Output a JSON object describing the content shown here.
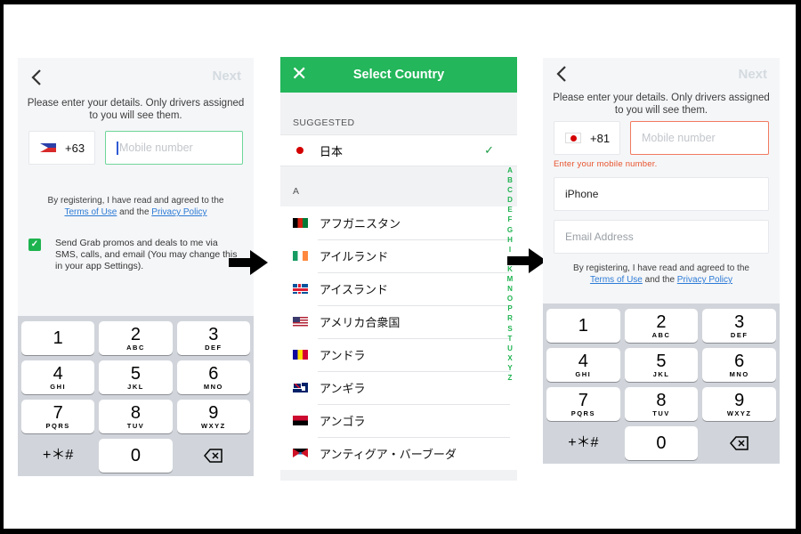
{
  "screen1": {
    "back_label": "‹",
    "next_label": "Next",
    "intro": "Please enter your details. Only drivers assigned to you will see them.",
    "country_code": "+63",
    "country_flag": "philippines-flag",
    "mobile_placeholder": "Mobile number",
    "terms_prefix": "By registering, I have read and agreed to the",
    "terms_link": "Terms of Use",
    "terms_mid": "and the",
    "privacy_link": "Privacy Policy",
    "promo_checked": true,
    "promo_text": "Send Grab promos and deals to me via SMS, calls, and email (You may change this in your app Settings)."
  },
  "screen2": {
    "title": "Select Country",
    "close_icon": "close-icon",
    "suggested_header": "SUGGESTED",
    "suggested": [
      {
        "name": "日本",
        "flag": "japan-flag",
        "selected": true
      }
    ],
    "section_header": "A",
    "countries": [
      {
        "name": "アフガニスタン",
        "flag": "af"
      },
      {
        "name": "アイルランド",
        "flag": "ie"
      },
      {
        "name": "アイスランド",
        "flag": "is"
      },
      {
        "name": "アメリカ合衆国",
        "flag": "us"
      },
      {
        "name": "アンドラ",
        "flag": "ad"
      },
      {
        "name": "アンギラ",
        "flag": "ai"
      },
      {
        "name": "アンゴラ",
        "flag": "ao"
      },
      {
        "name": "アンティグア・バーブーダ",
        "flag": "ag"
      }
    ],
    "index_letters": [
      "A",
      "B",
      "C",
      "D",
      "E",
      "F",
      "G",
      "H",
      "I",
      "J",
      "K",
      "M",
      "N",
      "O",
      "P",
      "R",
      "S",
      "T",
      "U",
      "X",
      "Y",
      "Z"
    ],
    "accent_color": "#23b65a"
  },
  "screen3": {
    "back_label": "‹",
    "next_label": "Next",
    "intro": "Please enter your details. Only drivers assigned to you will see them.",
    "country_code": "+81",
    "country_flag": "japan-flag",
    "mobile_placeholder": "Mobile number",
    "error_message": "Enter your mobile number.",
    "name_value": "iPhone",
    "email_placeholder": "Email Address",
    "terms_prefix": "By registering, I have read and agreed to the",
    "terms_link": "Terms of Use",
    "terms_mid": "and the",
    "privacy_link": "Privacy Policy",
    "error_color": "#e8532d"
  },
  "keypad": {
    "keys": [
      {
        "n": "1",
        "l": ""
      },
      {
        "n": "2",
        "l": "ABC"
      },
      {
        "n": "3",
        "l": "DEF"
      },
      {
        "n": "4",
        "l": "GHI"
      },
      {
        "n": "5",
        "l": "JKL"
      },
      {
        "n": "6",
        "l": "MNO"
      },
      {
        "n": "7",
        "l": "PQRS"
      },
      {
        "n": "8",
        "l": "TUV"
      },
      {
        "n": "9",
        "l": "WXYZ"
      }
    ],
    "symbols": "+＊#",
    "zero": "0",
    "delete_icon": "backspace-icon"
  }
}
